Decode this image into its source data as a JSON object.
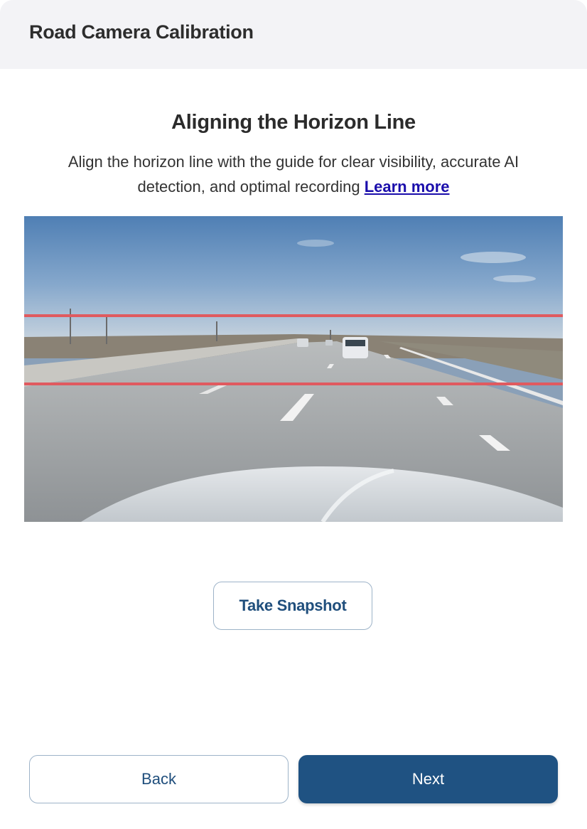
{
  "header": {
    "title": "Road Camera Calibration"
  },
  "main": {
    "title": "Aligning the Horizon Line",
    "description": "Align the horizon line with the guide for clear visibility, accurate AI detection, and optimal recording",
    "learn_more_label": "Learn more",
    "camera_view": {
      "guide_line_color": "#e05a5f"
    },
    "snapshot_label": "Take Snapshot"
  },
  "footer": {
    "back_label": "Back",
    "next_label": "Next"
  },
  "colors": {
    "accent": "#1f5282",
    "link": "#1a0dab",
    "header_bg": "#f3f3f6"
  }
}
